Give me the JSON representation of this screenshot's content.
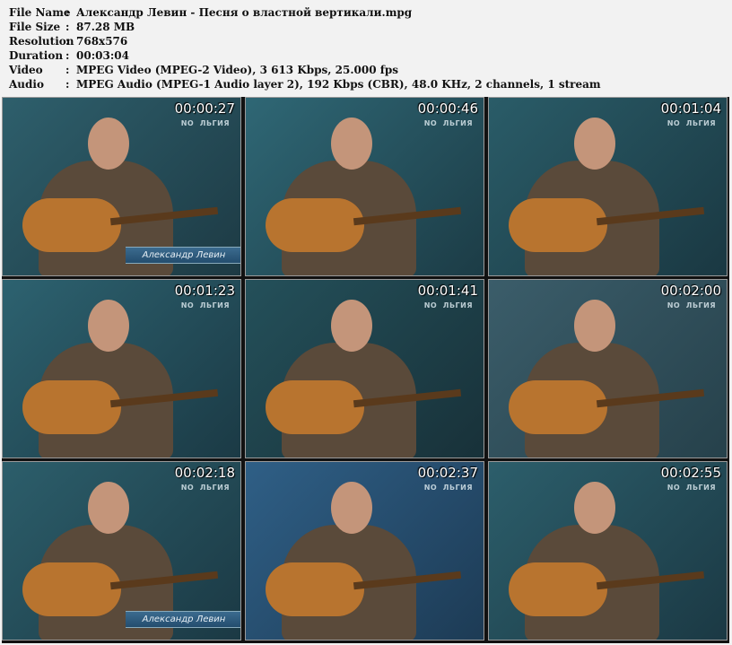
{
  "info": {
    "file_name": {
      "label": "File Name",
      "value": "Александр Левин - Песня о властной вертикали.mpg"
    },
    "file_size": {
      "label": "File Size",
      "value": "87.28 MB"
    },
    "resolution": {
      "label": "Resolution",
      "value": "768x576"
    },
    "duration": {
      "label": "Duration",
      "value": "00:03:04"
    },
    "video": {
      "label": "Video",
      "value": "MPEG Video (MPEG-2 Video), 3 613 Kbps, 25.000 fps"
    },
    "audio": {
      "label": "Audio",
      "value": "MPEG Audio (MPEG-1 Audio layer 2), 192 Kbps (CBR), 48.0 KHz, 2 channels, 1 stream"
    },
    "separator": ":"
  },
  "thumbnails": [
    {
      "time": "00:00:27",
      "logo": "NO  ЛЬГИЯ",
      "caption": "Александр Левин"
    },
    {
      "time": "00:00:46",
      "logo": "NO  ЛЬГИЯ"
    },
    {
      "time": "00:01:04",
      "logo": "NO  ЛЬГИЯ"
    },
    {
      "time": "00:01:23",
      "logo": "NO  ЛЬГИЯ"
    },
    {
      "time": "00:01:41",
      "logo": "NO  ЛЬГИЯ"
    },
    {
      "time": "00:02:00",
      "logo": "NO  ЛЬГИЯ"
    },
    {
      "time": "00:02:18",
      "logo": "NO  ЛЬГИЯ",
      "caption": "Александр Левин"
    },
    {
      "time": "00:02:37",
      "logo": "NO  ЛЬГИЯ"
    },
    {
      "time": "00:02:55",
      "logo": "NO  ЛЬГИЯ"
    }
  ]
}
